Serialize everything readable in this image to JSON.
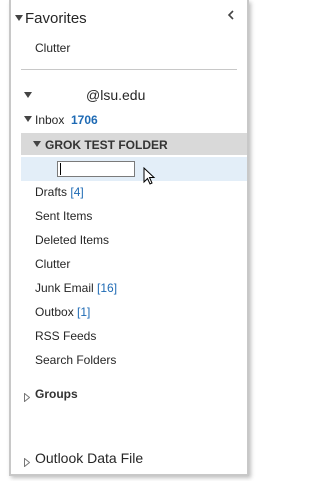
{
  "favorites": {
    "header": "Favorites",
    "items": [
      {
        "label": "Clutter"
      }
    ]
  },
  "account": {
    "email_domain": "@lsu.edu"
  },
  "inbox": {
    "label": "Inbox",
    "unread": "1706"
  },
  "selected_folder": {
    "label": "GROK TEST FOLDER"
  },
  "new_folder_input": {
    "value": ""
  },
  "folders": [
    {
      "label": "Drafts",
      "count": "[4]"
    },
    {
      "label": "Sent Items",
      "count": ""
    },
    {
      "label": "Deleted Items",
      "count": ""
    },
    {
      "label": "Clutter",
      "count": ""
    },
    {
      "label": "Junk Email",
      "count": "[16]"
    },
    {
      "label": "Outbox",
      "count": "[1]"
    },
    {
      "label": "RSS Feeds",
      "count": ""
    },
    {
      "label": "Search Folders",
      "count": ""
    }
  ],
  "groups": {
    "label": "Groups"
  },
  "data_file": {
    "label": "Outlook Data File"
  },
  "icons": {
    "collapse": "chevron-left-icon",
    "expanded": "triangle-down-icon",
    "collapsed": "triangle-right-icon",
    "pointer": "mouse-pointer-icon"
  },
  "colors": {
    "count_blue": "#1e6ab4",
    "selection_gray": "#d9d9d9",
    "edit_highlight": "#e3eef8"
  }
}
